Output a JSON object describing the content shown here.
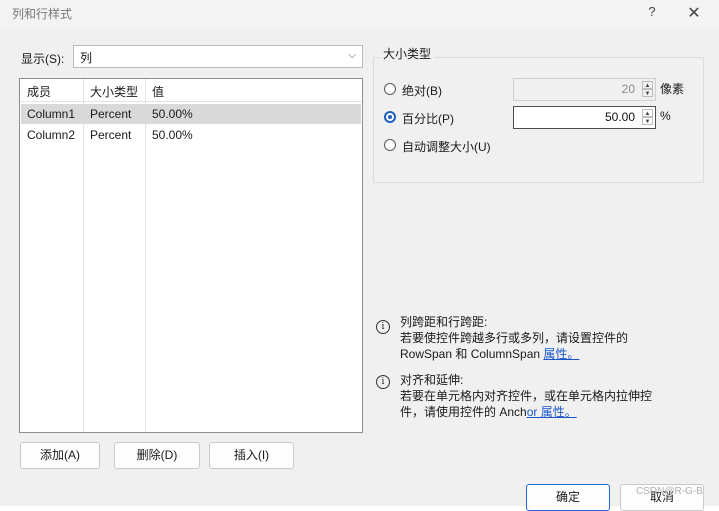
{
  "window": {
    "title": "列和行样式",
    "help_glyph": "?",
    "close_glyph": "✕"
  },
  "show": {
    "label": "显示(S):",
    "selected": "列",
    "arrow": "⌵"
  },
  "table": {
    "headers": [
      "成员",
      "大小类型",
      "值"
    ],
    "rows": [
      {
        "member": "Column1",
        "size_type": "Percent",
        "value": "50.00%",
        "selected": true
      },
      {
        "member": "Column2",
        "size_type": "Percent",
        "value": "50.00%",
        "selected": false
      }
    ]
  },
  "buttons": {
    "add": "添加(A)",
    "delete": "删除(D)",
    "insert": "插入(I)",
    "ok": "确定",
    "cancel": "取消"
  },
  "size_type": {
    "group_title": "大小类型",
    "absolute": {
      "label": "绝对(B)",
      "value": "20",
      "unit": "像素",
      "checked": false
    },
    "percent": {
      "label": "百分比(P)",
      "value": "50.00",
      "unit": "%",
      "checked": true
    },
    "autosize": {
      "label": "自动调整大小(U)",
      "checked": false
    }
  },
  "info": {
    "span": {
      "title": "列跨距和行跨距:",
      "line1": "若要使控件跨越多行或多列，请设置控件的",
      "line2_prefix": "RowSpan 和 ColumnSpan ",
      "link": "属性。"
    },
    "align": {
      "title": "对齐和延伸:",
      "line1": "若要在单元格内对齐控件，或在单元格内拉伸控",
      "line2_prefix": "件，请使用控件的 Anch",
      "link": "or 属性。"
    }
  },
  "watermark": "CSDN@R-G-B"
}
